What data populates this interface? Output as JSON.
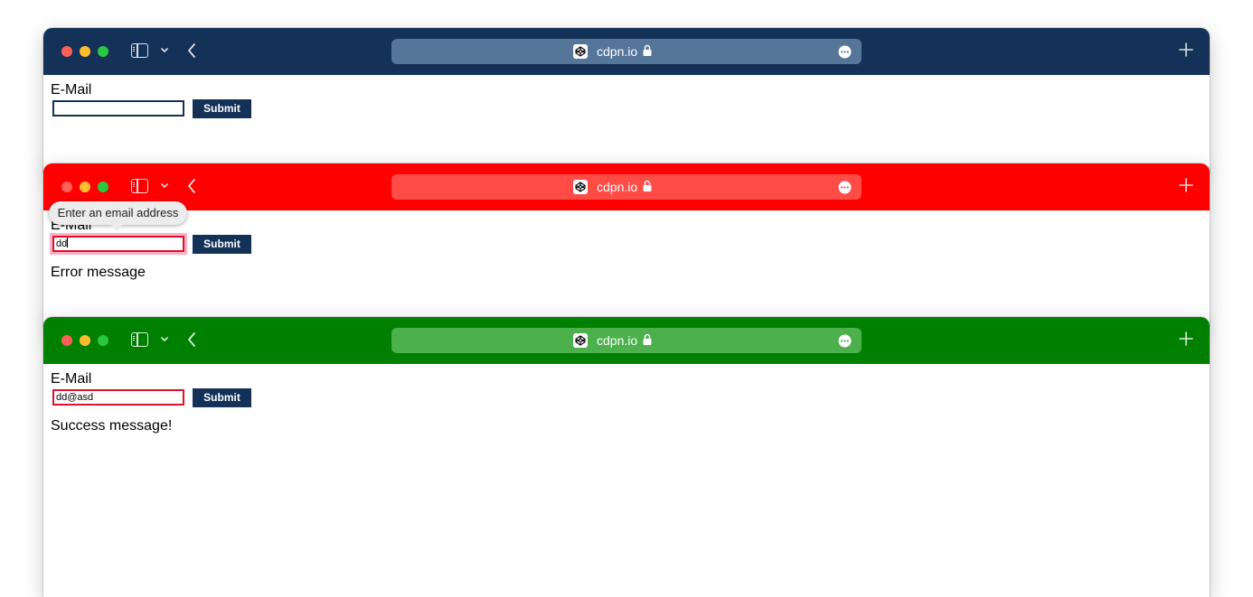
{
  "colors": {
    "window1_toolbar": "#143257",
    "window2_toolbar": "#fe0000",
    "window3_toolbar": "#008000",
    "button_bg": "#143257",
    "error_border": "#e0102a"
  },
  "windows": [
    {
      "state": "default",
      "url": "cdpn.io",
      "form": {
        "label": "E-Mail",
        "input_value": "",
        "submit_label": "Submit"
      },
      "message": ""
    },
    {
      "state": "error",
      "url": "cdpn.io",
      "tooltip": "Enter an email address",
      "form": {
        "label": "E-Mail",
        "input_value": "dd",
        "submit_label": "Submit"
      },
      "message": "Error message"
    },
    {
      "state": "success",
      "url": "cdpn.io",
      "form": {
        "label": "E-Mail",
        "input_value": "dd@asd",
        "submit_label": "Submit"
      },
      "message": "Success message!"
    }
  ],
  "icons": [
    "sidebar-icon",
    "chevron-down-icon",
    "back-icon",
    "site-icon",
    "lock-icon",
    "more-icon",
    "plus-icon"
  ]
}
